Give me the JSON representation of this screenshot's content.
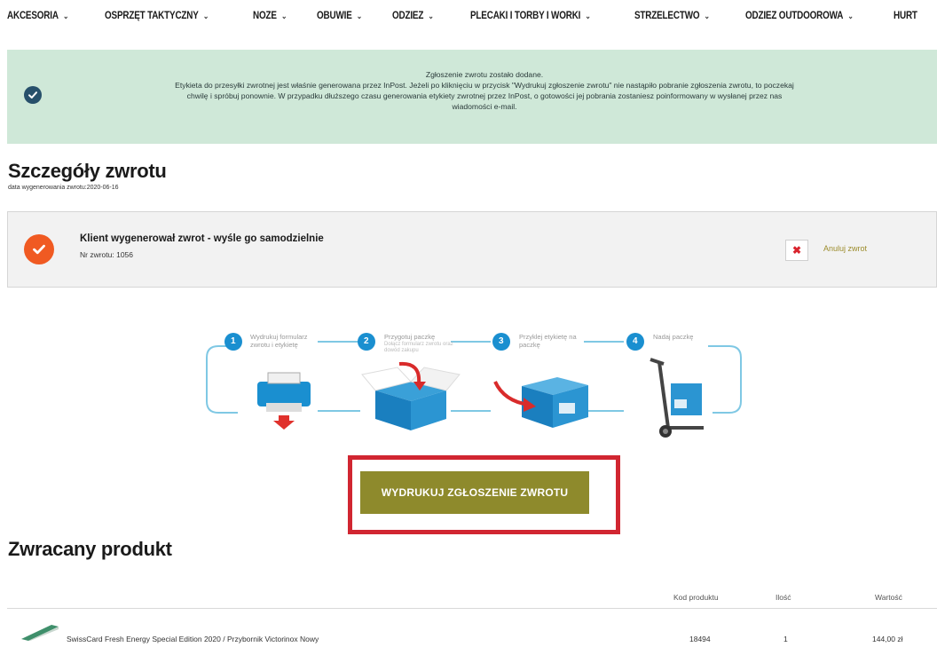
{
  "nav": {
    "items": [
      {
        "label": "AKCESORIA",
        "chevron": true
      },
      {
        "label": "OSPRZĘT TAKTYCZNY",
        "chevron": true
      },
      {
        "label": "NOZE",
        "chevron": true
      },
      {
        "label": "OBUWIE",
        "chevron": true
      },
      {
        "label": "ODZIEZ",
        "chevron": true
      },
      {
        "label": "PLECAKI I TORBY I WORKI",
        "chevron": true
      },
      {
        "label": "STRZELECTWO",
        "chevron": true
      },
      {
        "label": "ODZIEZ OUTDOOROWA",
        "chevron": true
      },
      {
        "label": "HURT",
        "chevron": false
      }
    ]
  },
  "alert": {
    "line1": "Zgłoszenie zwrotu zostało dodane.",
    "line2": "Etykieta do przesyłki zwrotnej jest właśnie generowana przez InPost. Jeżeli po kliknięciu w przycisk \"Wydrukuj zgłoszenie zwrotu\" nie nastąpiło pobranie zgłoszenia zwrotu, to poczekaj",
    "line3": "chwilę i spróbuj ponownie. W przypadku dłuższego czasu generowania etykiety zwrotnej przez InPost, o gotowości jej pobrania zostaniesz poinformowany w wysłanej przez nas",
    "line4": "wiadomości e-mail.",
    "icon": "check-circle-icon",
    "color": "#cfe8d8"
  },
  "details": {
    "title": "Szczegóły zwrotu",
    "date_label": "data wygenerowania zwrotu:2020-06-16"
  },
  "status": {
    "title": "Klient wygenerował zwrot - wyśle go samodzielnie",
    "number_label": "Nr zwrotu: 1056",
    "cancel_label": "Anuluj zwrot",
    "accent": "#f05a22"
  },
  "steps": [
    {
      "num": "1",
      "label_l1": "Wydrukuj formularz",
      "label_l2": "zwrotu i etykietę",
      "sub": ""
    },
    {
      "num": "2",
      "label_l1": "Przygotuj paczkę",
      "label_l2": "",
      "sub": "Dołącz formularz zwrotu oraz dowód zakupu"
    },
    {
      "num": "3",
      "label_l1": "Przyklej etykietę na",
      "label_l2": "paczkę",
      "sub": ""
    },
    {
      "num": "4",
      "label_l1": "Nadaj paczkę",
      "label_l2": "",
      "sub": ""
    }
  ],
  "print_button": {
    "label": "WYDRUKUJ ZGŁOSZENIE ZWROTU",
    "color": "#8e8a2c",
    "highlight": "#d12631"
  },
  "product": {
    "title": "Zwracany produkt",
    "columns": {
      "code": "Kod produktu",
      "qty": "Ilość",
      "value": "Wartość"
    },
    "rows": [
      {
        "name": "SwissCard Fresh Energy Special Edition 2020 / Przybornik Victorinox Nowy",
        "code": "18494",
        "qty": "1",
        "value": "144,00 zł"
      }
    ]
  }
}
